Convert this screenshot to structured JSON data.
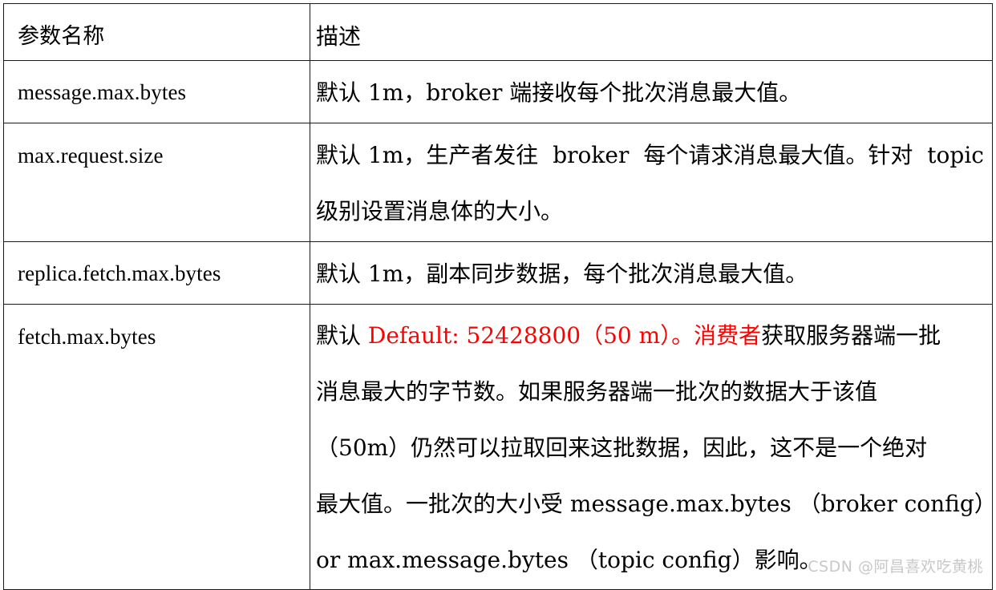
{
  "document": {
    "type": "parameter-reference-table",
    "watermark": "CSDN @阿昌喜欢吃黄桃"
  },
  "table": {
    "headers": {
      "name": "参数名称",
      "description": "描述"
    },
    "rows": [
      {
        "name": "message.max.bytes",
        "lines": [
          {
            "segments": [
              {
                "text": "默认 1m，broker 端接收每个批次消息最大值。",
                "color": "black"
              }
            ],
            "justify": false
          }
        ]
      },
      {
        "name": "max.request.size",
        "lines": [
          {
            "segments": [
              {
                "text": "默认 1m，生产者发往 broker 每个请求消息最大值。针对 topic",
                "color": "black"
              }
            ],
            "justify": true,
            "parts": [
              "默认 1m，生产者发往",
              "broker",
              "每个请求消息最大值。针对",
              "topic"
            ]
          },
          {
            "segments": [
              {
                "text": "级别设置消息体的大小。",
                "color": "black"
              }
            ],
            "justify": false
          }
        ]
      },
      {
        "name": "replica.fetch.max.bytes",
        "lines": [
          {
            "segments": [
              {
                "text": "默认 1m，副本同步数据，每个批次消息最大值。",
                "color": "black"
              }
            ],
            "justify": false
          }
        ]
      },
      {
        "name": "fetch.max.bytes",
        "lines": [
          {
            "segments": [
              {
                "text": "默认 ",
                "color": "black"
              },
              {
                "text": "Default: 52428800（50 m）。消费者",
                "color": "red"
              },
              {
                "text": "获取服务器端一批",
                "color": "black"
              }
            ],
            "justify": false
          },
          {
            "segments": [
              {
                "text": "消息最大的字节数。如果服务器端一批次的数据大于该值",
                "color": "black"
              }
            ],
            "justify": true,
            "parts": [
              "消息最大的字节数。如果服务器端一批次的数据大于该值"
            ]
          },
          {
            "segments": [
              {
                "text": "（50m）仍然可以拉取回来这批数据，因此，这不是一个绝对",
                "color": "black"
              }
            ],
            "justify": false
          },
          {
            "segments": [
              {
                "text": "最大值。一批次的大小受 message.max.bytes （broker config）",
                "color": "black"
              }
            ],
            "justify": false
          },
          {
            "segments": [
              {
                "text": "or max.message.bytes （topic config）影响。",
                "color": "black"
              }
            ],
            "justify": false
          }
        ]
      }
    ]
  },
  "colors": {
    "text": "#000000",
    "highlight": "#ff0000",
    "border": "#1a1a1a",
    "watermark": "#c8c8c8",
    "background": "#ffffff"
  }
}
